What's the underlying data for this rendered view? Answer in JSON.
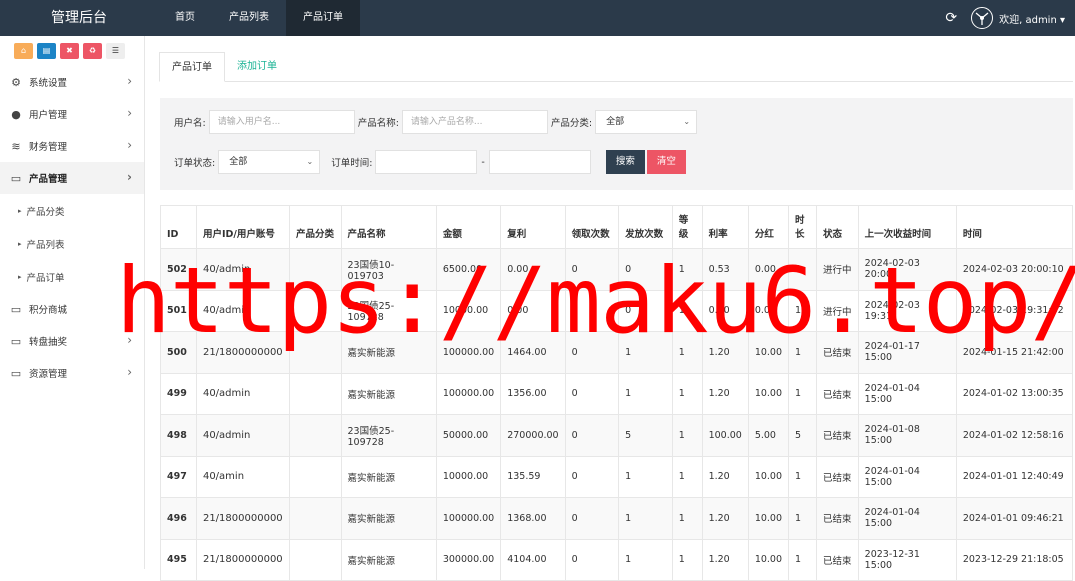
{
  "app": {
    "title": "管理后台"
  },
  "topnav": [
    {
      "label": "首页"
    },
    {
      "label": "产品列表"
    },
    {
      "label": "产品订单"
    }
  ],
  "topright": {
    "welcome": "欢迎, admin ▾",
    "refresh_icon": "refresh-icon"
  },
  "sidebar": {
    "tools": [
      {
        "icon": "home-icon",
        "glyph": "⌂",
        "color": "#f8ac59"
      },
      {
        "icon": "file-icon",
        "glyph": "▤",
        "color": "#1c84c6"
      },
      {
        "icon": "trash-icon",
        "glyph": "🗑",
        "color": "#ed5565"
      },
      {
        "icon": "recycle-icon",
        "glyph": "♻",
        "color": "#ed5565"
      },
      {
        "icon": "list-icon",
        "glyph": "☰",
        "color": "#eeeeee"
      }
    ],
    "items": [
      {
        "label": "系统设置",
        "glyph": "⚙"
      },
      {
        "label": "用户管理",
        "glyph": "👤"
      },
      {
        "label": "财务管理",
        "glyph": "≋"
      },
      {
        "label": "产品管理",
        "glyph": "▭"
      },
      {
        "label": "积分商城",
        "glyph": "▭"
      },
      {
        "label": "转盘抽奖",
        "glyph": "▭"
      },
      {
        "label": "资源管理",
        "glyph": "▭"
      }
    ],
    "subitems": [
      {
        "label": "产品分类"
      },
      {
        "label": "产品列表"
      },
      {
        "label": "产品订单"
      }
    ]
  },
  "tabs": [
    {
      "label": "产品订单"
    },
    {
      "label": "添加订单"
    }
  ],
  "filter": {
    "username_label": "用户名:",
    "username_placeholder": "请输入用户名...",
    "product_label": "产品名称:",
    "product_placeholder": "请输入产品名称...",
    "category_label": "产品分类:",
    "category_value": "全部",
    "status_label": "订单状态:",
    "status_value": "全部",
    "time_label": "订单时间:",
    "time_sep": "-",
    "search_button": "搜索",
    "clear_button": "清空"
  },
  "table": {
    "headers": [
      "ID",
      "用户ID/用户账号",
      "产品分类",
      "产品名称",
      "金额",
      "复利",
      "领取次数",
      "发放次数",
      "等级",
      "利率",
      "分红",
      "时长",
      "状态",
      "上一次收益时间",
      "时间"
    ],
    "rows": [
      [
        "502",
        "40/admin",
        "",
        "23国债10-019703",
        "6500.00",
        "0.00",
        "0",
        "0",
        "1",
        "0.53",
        "0.00",
        "3",
        "进行中",
        "2024-02-03 20:00",
        "2024-02-03 20:00:10"
      ],
      [
        "501",
        "40/admin",
        "",
        "23国债25-109728",
        "10000.00",
        "0.00",
        "0",
        "0",
        "1",
        "0.50",
        "0.00",
        "1",
        "进行中",
        "2024-02-03 19:31",
        "2024-02-03 19:31:32"
      ],
      [
        "500",
        "21/1800000000",
        "",
        "嘉实新能源",
        "100000.00",
        "1464.00",
        "0",
        "1",
        "1",
        "1.20",
        "10.00",
        "1",
        "已结束",
        "2024-01-17 15:00",
        "2024-01-15 21:42:00"
      ],
      [
        "499",
        "40/admin",
        "",
        "嘉实新能源",
        "100000.00",
        "1356.00",
        "0",
        "1",
        "1",
        "1.20",
        "10.00",
        "1",
        "已结束",
        "2024-01-04 15:00",
        "2024-01-02 13:00:35"
      ],
      [
        "498",
        "40/admin",
        "",
        "23国债25-109728",
        "50000.00",
        "270000.00",
        "0",
        "5",
        "1",
        "100.00",
        "5.00",
        "5",
        "已结束",
        "2024-01-08 15:00",
        "2024-01-02 12:58:16"
      ],
      [
        "497",
        "40/amin",
        "",
        "嘉实新能源",
        "10000.00",
        "135.59",
        "0",
        "1",
        "1",
        "1.20",
        "10.00",
        "1",
        "已结束",
        "2024-01-04 15:00",
        "2024-01-01 12:40:49"
      ],
      [
        "496",
        "21/1800000000",
        "",
        "嘉实新能源",
        "100000.00",
        "1368.00",
        "0",
        "1",
        "1",
        "1.20",
        "10.00",
        "1",
        "已结束",
        "2024-01-04 15:00",
        "2024-01-01 09:46:21"
      ],
      [
        "495",
        "21/1800000000",
        "",
        "嘉实新能源",
        "300000.00",
        "4104.00",
        "0",
        "1",
        "1",
        "1.20",
        "10.00",
        "1",
        "已结束",
        "2023-12-31 15:00",
        "2023-12-29 21:18:05"
      ]
    ]
  },
  "watermark": "https://maku6.top/"
}
